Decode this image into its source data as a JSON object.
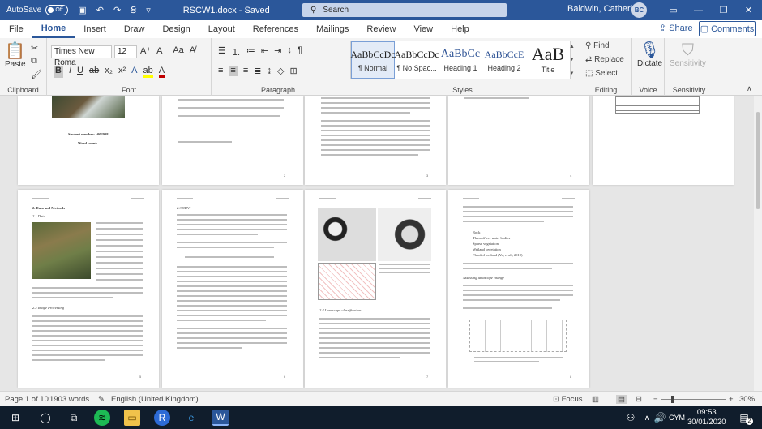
{
  "titlebar": {
    "autosave_label": "AutoSave",
    "autosave_state": "Off",
    "doc_title": "RSCW1.docx - Saved",
    "search_placeholder": "Search",
    "user_name": "Baldwin, Catherine",
    "user_initials": "BC"
  },
  "menu": {
    "tabs": [
      "File",
      "Home",
      "Insert",
      "Draw",
      "Design",
      "Layout",
      "References",
      "Mailings",
      "Review",
      "View",
      "Help"
    ],
    "active_tab": "Home",
    "share_label": "Share",
    "comments_label": "Comments"
  },
  "ribbon": {
    "clipboard": {
      "paste_label": "Paste",
      "group_label": "Clipboard"
    },
    "font": {
      "font_name": "Times New Roma",
      "font_size": "12",
      "group_label": "Font"
    },
    "paragraph": {
      "group_label": "Paragraph"
    },
    "styles": {
      "group_label": "Styles",
      "items": [
        {
          "preview": "AaBbCcDc",
          "name": "¶ Normal"
        },
        {
          "preview": "AaBbCcDc",
          "name": "¶ No Spac..."
        },
        {
          "preview": "AaBbCc",
          "name": "Heading 1"
        },
        {
          "preview": "AaBbCcE",
          "name": "Heading 2"
        },
        {
          "preview": "AaB",
          "name": "Title"
        }
      ]
    },
    "editing": {
      "group_label": "Editing",
      "find_label": "Find",
      "replace_label": "Replace",
      "select_label": "Select"
    },
    "voice": {
      "dictate_label": "Dictate",
      "group_label": "Voice"
    },
    "sensitivity": {
      "label": "Sensitivity",
      "group_label": "Sensitivity"
    }
  },
  "pages_text": {
    "p1_title": "Student number: c002938",
    "p1_sub": "Word count:",
    "p6_heading": "2.3 NDVI",
    "p8_heading1": "Assessing landscape change",
    "p5_heading1": "2. Data and Methods",
    "p5_heading2": "2.1 Data",
    "p5_heading3": "2.2 Image Processing",
    "p7_heading": "2.4 Landscape classification",
    "p8_list": [
      "Rock",
      "Thawed/wet water bodies",
      "Sparse vegetation",
      "Wetland vegetation",
      "Flooded wetland (Yu, et al., 2019)"
    ],
    "page_numbers": [
      "1",
      "2",
      "3",
      "4",
      "5",
      "6",
      "7",
      "8"
    ]
  },
  "statusbar": {
    "page": "Page 1 of 10",
    "words": "1903 words",
    "language": "English (United Kingdom)",
    "focus_label": "Focus",
    "zoom": "30%"
  },
  "taskbar": {
    "lang": "CYM",
    "time": "09:53",
    "date": "30/01/2020",
    "notifications": "2"
  },
  "colors": {
    "word_blue": "#2b579a",
    "taskbar_bg": "#101d2c"
  }
}
